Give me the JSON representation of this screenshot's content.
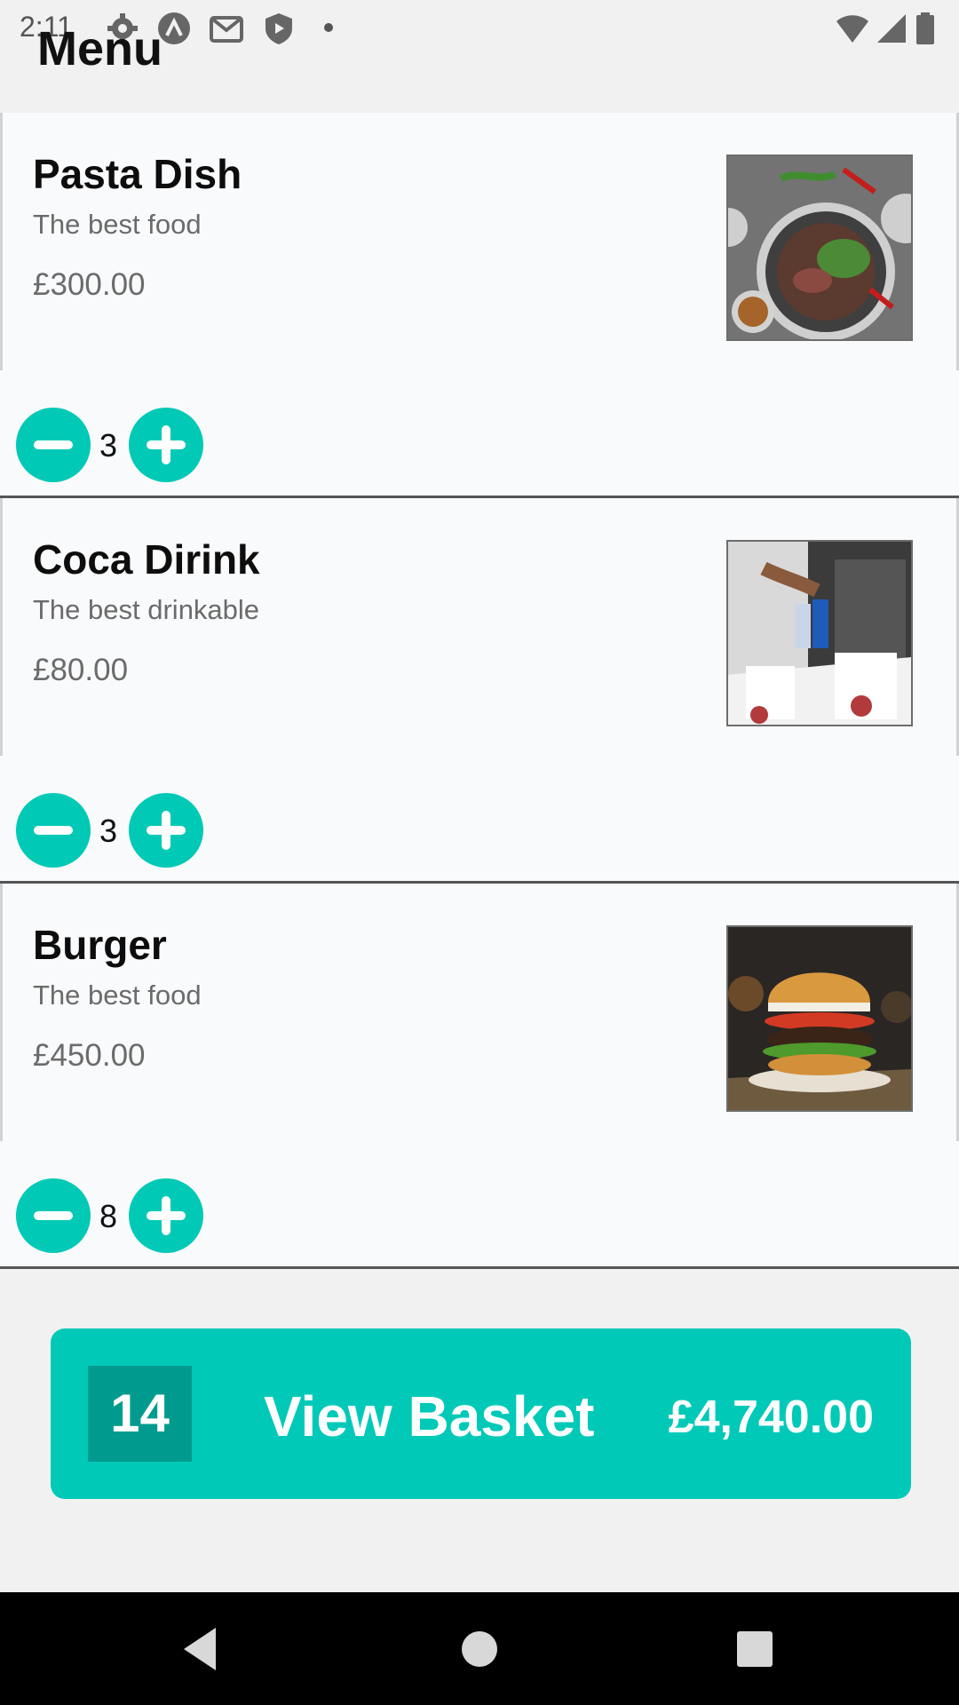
{
  "status_bar": {
    "time": "2:11",
    "left_icons": [
      "gear-icon",
      "vpn-icon",
      "gmail-icon",
      "shield-icon",
      "dot-icon"
    ],
    "right_icons": [
      "wifi-icon",
      "signal-icon",
      "battery-icon"
    ]
  },
  "header": {
    "title": "Menu"
  },
  "menu": {
    "items": [
      {
        "name": "Pasta Dish",
        "description": "The best food",
        "price": "£300.00",
        "quantity": "3",
        "image": "pasta-dish-photo"
      },
      {
        "name": "Coca Dirink",
        "description": "The best drinkable",
        "price": "£80.00",
        "quantity": "3",
        "image": "drink-photo"
      },
      {
        "name": "Burger",
        "description": "The best food",
        "price": "£450.00",
        "quantity": "8",
        "image": "burger-photo"
      }
    ]
  },
  "basket": {
    "count": "14",
    "label": "View Basket",
    "total": "£4,740.00"
  },
  "colors": {
    "accent": "#00c9b8",
    "accent_dark": "#009b8e",
    "card_background": "#f9fafc",
    "page_background": "#f1f1f1"
  },
  "nav": {
    "buttons": [
      "back-icon",
      "home-icon",
      "recents-icon"
    ]
  }
}
